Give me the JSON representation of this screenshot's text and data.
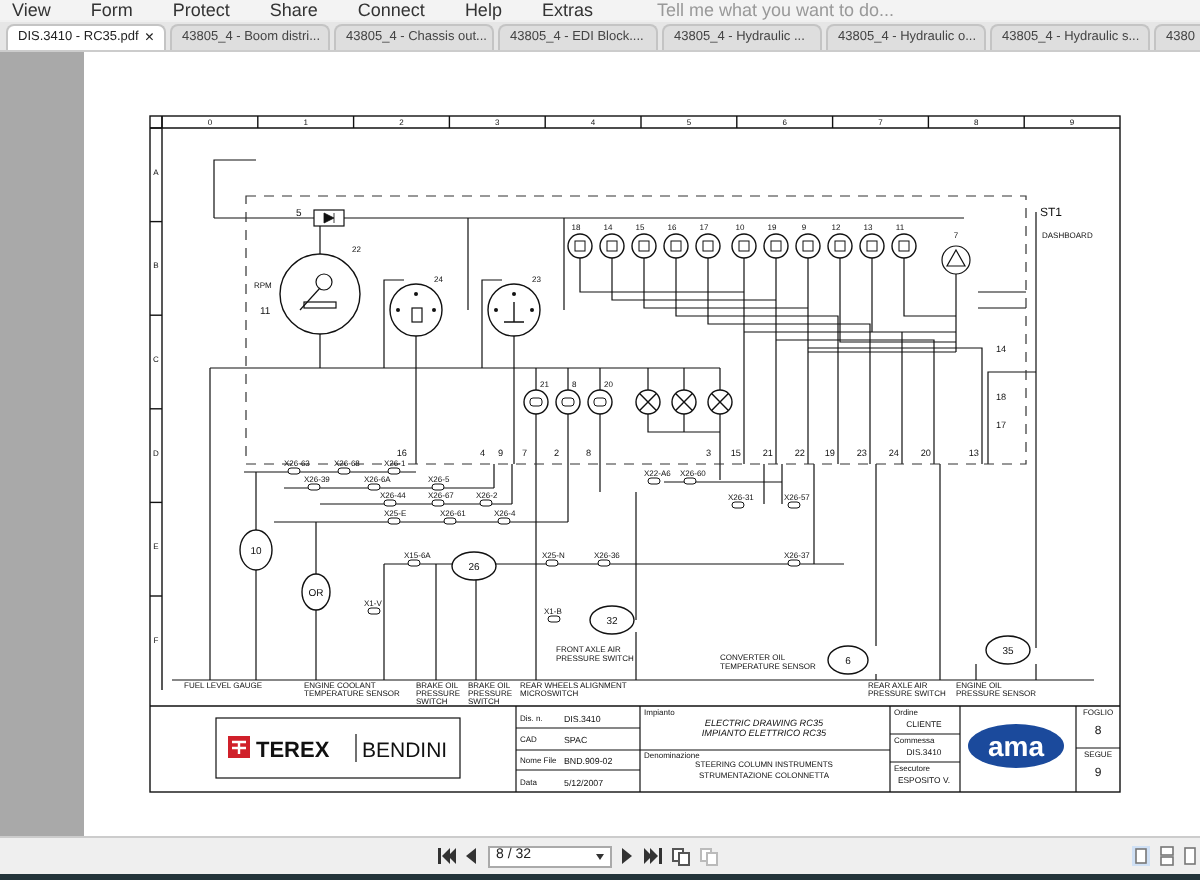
{
  "menu": [
    "View",
    "Form",
    "Protect",
    "Share",
    "Connect",
    "Help",
    "Extras"
  ],
  "search": {
    "placeholder": "Tell me what you want to do..."
  },
  "tabs": [
    {
      "label": "DIS.3410 - RC35.pdf",
      "selected": true,
      "close": "×"
    },
    {
      "label": "43805_4 - Boom distri...",
      "selected": false
    },
    {
      "label": "43805_4 - Chassis out...",
      "selected": false
    },
    {
      "label": "43805_4 - EDI Block....",
      "selected": false
    },
    {
      "label": "43805_4 - Hydraulic ...",
      "selected": false
    },
    {
      "label": "43805_4 - Hydraulic o...",
      "selected": false
    },
    {
      "label": "43805_4 - Hydraulic s...",
      "selected": false
    },
    {
      "label": "4380",
      "selected": false
    }
  ],
  "drawing": {
    "columns": [
      "0",
      "1",
      "2",
      "3",
      "4",
      "5",
      "6",
      "7",
      "8",
      "9"
    ],
    "rows": [
      "A",
      "B",
      "C",
      "D",
      "E",
      "F"
    ],
    "panel": {
      "label": "ST1",
      "caption": "DASHBOARD"
    },
    "fuse": "5",
    "gauges": [
      {
        "number": "22",
        "kind": "tachometer",
        "label": "RPM",
        "code": "11"
      },
      {
        "number": "24",
        "kind": "fuel"
      },
      {
        "number": "23",
        "kind": "temperature"
      }
    ],
    "indicators": [
      {
        "number": "18",
        "kind": "lamp"
      },
      {
        "number": "14",
        "kind": "lamp"
      },
      {
        "number": "15",
        "kind": "lamp"
      },
      {
        "number": "16",
        "kind": "lamp"
      },
      {
        "number": "17",
        "kind": "lamp"
      },
      {
        "number": "10",
        "kind": "lamp"
      },
      {
        "number": "19",
        "kind": "lamp"
      },
      {
        "number": "9",
        "kind": "lamp"
      },
      {
        "number": "12",
        "kind": "lamp"
      },
      {
        "number": "13",
        "kind": "lamp"
      },
      {
        "number": "11",
        "kind": "lamp"
      },
      {
        "number": "7",
        "kind": "warning"
      }
    ],
    "lamps": [
      {
        "number": "21",
        "kind": "lamp"
      },
      {
        "number": "8",
        "kind": "lamp"
      },
      {
        "number": "20",
        "kind": "lamp"
      },
      {
        "kind": "bulb"
      },
      {
        "kind": "bulb"
      },
      {
        "kind": "bulb"
      }
    ],
    "terminals": [
      "16",
      "4",
      "9",
      "7",
      "2",
      "8",
      "3",
      "15",
      "21",
      "22",
      "19",
      "23",
      "24",
      "20",
      "13"
    ],
    "side_terminals": [
      "14",
      "18",
      "17"
    ],
    "connectors": [
      "X26-63",
      "X26-68",
      "X26-1",
      "X26-39",
      "X26-6A",
      "X26-5",
      "X26-44",
      "X26-67",
      "X26-2",
      "X25-E",
      "X26-61",
      "X26-4",
      "X15-6A",
      "X25-N",
      "X26-36",
      "X1-B",
      "X1-V",
      "X22-A6",
      "X26-60",
      "X26-31",
      "X26-57",
      "X26-37"
    ],
    "devices": [
      "10",
      "OR",
      "26",
      "32",
      "6",
      "35"
    ],
    "notes": [
      [
        "FRONT AXLE AIR",
        "PRESSURE SWITCH"
      ],
      [
        "CONVERTER OIL",
        "TEMPERATURE SENSOR"
      ]
    ],
    "captions": [
      [
        "FUEL LEVEL GAUGE"
      ],
      [
        "ENGINE COOLANT",
        "TEMPERATURE SENSOR"
      ],
      [
        "BRAKE OIL",
        "PRESSURE",
        "SWITCH"
      ],
      [
        "BRAKE OIL",
        "PRESSURE",
        "SWITCH"
      ],
      [
        "REAR WHEELS ALIGNMENT",
        "MICROSWITCH"
      ],
      [
        "REAR AXLE AIR",
        "PRESSURE SWITCH"
      ],
      [
        "ENGINE OIL",
        "PRESSURE SENSOR"
      ]
    ]
  },
  "title_block": {
    "brand": "TEREX",
    "brand2": "BENDINI",
    "fields": [
      {
        "label": "Dis. n.",
        "value": "DIS.3410"
      },
      {
        "label": "CAD",
        "value": "SPAC"
      },
      {
        "label": "Nome File",
        "value": "BND.909-02"
      },
      {
        "label": "Data",
        "value": "5/12/2007"
      }
    ],
    "impianto": {
      "label": "Impianto",
      "lines": [
        "ELECTRIC DRAWING RC35",
        "IMPIANTO ELETTRICO RC35"
      ]
    },
    "denominazione": {
      "label": "Denominazione",
      "lines": [
        "STEERING COLUMN INSTRUMENTS",
        "STRUMENTAZIONE COLONNETTA"
      ]
    },
    "order": [
      {
        "label": "Ordine",
        "value": "CLIENTE"
      },
      {
        "label": "Commessa",
        "value": "DIS.3410"
      },
      {
        "label": "Esecutore",
        "value": "ESPOSITO V."
      }
    ],
    "logo": "ama",
    "sheet": [
      {
        "label": "FOGLIO",
        "value": "8"
      },
      {
        "label": "SEGUE",
        "value": "9"
      }
    ]
  },
  "pager": {
    "value": "8 / 32"
  }
}
